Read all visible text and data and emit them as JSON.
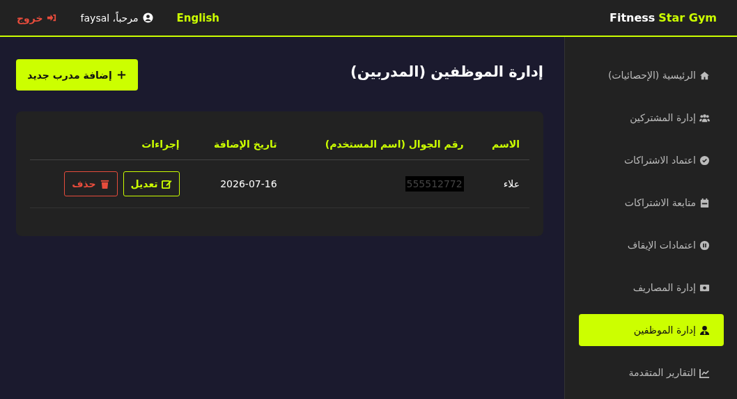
{
  "header": {
    "brand_name": "Fitness",
    "brand_accent": "Star Gym",
    "language_link": "English",
    "greeting": "مرحباً، faysal",
    "logout": "خروج"
  },
  "sidebar": {
    "items": [
      {
        "label": "الرئيسية (الإحصائيات)",
        "selected": false
      },
      {
        "label": "إدارة المشتركين",
        "selected": false
      },
      {
        "label": "اعتماد الاشتراكات",
        "selected": false
      },
      {
        "label": "متابعة الاشتراكات",
        "selected": false
      },
      {
        "label": "اعتمادات الإيقاف",
        "selected": false
      },
      {
        "label": "إدارة المصاريف",
        "selected": false
      },
      {
        "label": "إدارة الموظفين",
        "selected": true
      },
      {
        "label": "التقارير المتقدمة",
        "selected": false
      }
    ]
  },
  "page": {
    "title": "إدارة الموظفين (المدربين)",
    "add_button": "إضافة مدرب جديد"
  },
  "table": {
    "columns": [
      "الاسم",
      "رقم الجوال (اسم المستخدم)",
      "تاريخ الإضافة",
      "إجراءات"
    ],
    "rows": [
      {
        "name": "علاء",
        "phone": "555512772",
        "date": "2026-07-16",
        "edit": "تعديل",
        "delete": "حذف"
      }
    ]
  }
}
